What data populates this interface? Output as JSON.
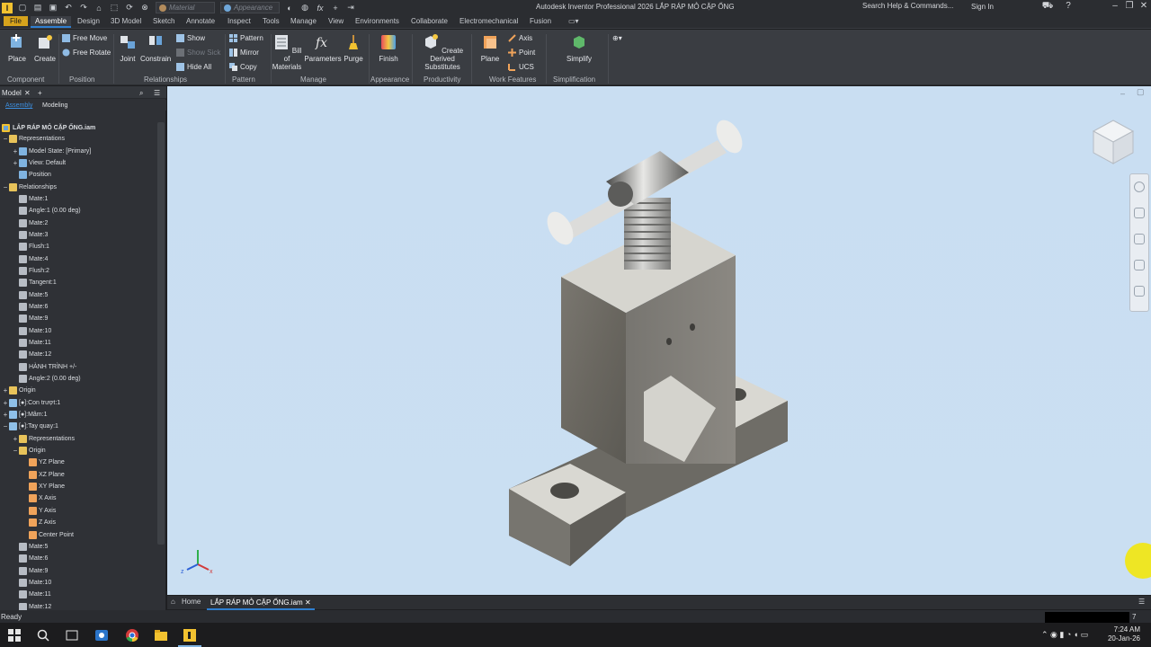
{
  "window": {
    "title": "Autodesk Inventor Professional 2026   LẮP RÁP MỎ CẶP ỐNG",
    "search_placeholder": "Search Help & Commands...",
    "sign_in": "Sign In",
    "material_placeholder": "Material",
    "appearance_placeholder": "Appearance",
    "app_logo": "I"
  },
  "ribbon_tabs": [
    "File",
    "Assemble",
    "Design",
    "3D Model",
    "Sketch",
    "Annotate",
    "Inspect",
    "Tools",
    "Manage",
    "View",
    "Environments",
    "Collaborate",
    "Electromechanical",
    "Fusion"
  ],
  "active_tab": "Assemble",
  "ribbon": {
    "place": "Place",
    "create": "Create",
    "free_move": "Free Move",
    "free_rotate": "Free Rotate",
    "joint": "Joint",
    "constrain": "Constrain",
    "show": "Show",
    "show_sick": "Show Sick",
    "hide_all": "Hide All",
    "pattern": "Pattern",
    "mirror": "Mirror",
    "copy": "Copy",
    "bom_1": "Bill of",
    "bom_2": "Materials",
    "parameters": "Parameters",
    "purge": "Purge",
    "finish": "Finish",
    "derived_1": "Create Derived",
    "derived_2": "Substitutes",
    "plane": "Plane",
    "axis": "Axis",
    "point": "Point",
    "ucs": "UCS",
    "simplify": "Simplify",
    "panels": {
      "component": "Component",
      "position": "Position",
      "relationships": "Relationships",
      "pattern": "Pattern",
      "manage": "Manage",
      "appearance": "Appearance",
      "productivity": "Productivity",
      "work_features": "Work Features",
      "simplification": "Simplification"
    }
  },
  "browser": {
    "title": "Model",
    "tab_assembly": "Assembly",
    "tab_modeling": "Modeling",
    "root": "LẮP RÁP MỎ CẶP ỐNG.iam",
    "items": [
      {
        "label": "Representations",
        "level": 1,
        "exp": "−",
        "icon": "folder-icon"
      },
      {
        "label": "Model State: [Primary]",
        "level": 2,
        "exp": "+",
        "icon": "model-state-icon"
      },
      {
        "label": "View: Default",
        "level": 2,
        "exp": "+",
        "icon": "view-icon"
      },
      {
        "label": "Position",
        "level": 2,
        "exp": "",
        "icon": "position-icon"
      },
      {
        "label": "Relationships",
        "level": 1,
        "exp": "−",
        "icon": "folder-icon"
      },
      {
        "label": "Mate:1",
        "level": 2,
        "exp": "",
        "icon": "mate-icon"
      },
      {
        "label": "Angle:1 (0.00 deg)",
        "level": 2,
        "exp": "",
        "icon": "angle-icon"
      },
      {
        "label": "Mate:2",
        "level": 2,
        "exp": "",
        "icon": "mate-icon"
      },
      {
        "label": "Mate:3",
        "level": 2,
        "exp": "",
        "icon": "mate-icon"
      },
      {
        "label": "Flush:1",
        "level": 2,
        "exp": "",
        "icon": "flush-icon"
      },
      {
        "label": "Mate:4",
        "level": 2,
        "exp": "",
        "icon": "mate-icon"
      },
      {
        "label": "Flush:2",
        "level": 2,
        "exp": "",
        "icon": "flush-icon"
      },
      {
        "label": "Tangent:1",
        "level": 2,
        "exp": "",
        "icon": "tangent-icon"
      },
      {
        "label": "Mate:5",
        "level": 2,
        "exp": "",
        "icon": "mate-icon"
      },
      {
        "label": "Mate:6",
        "level": 2,
        "exp": "",
        "icon": "mate-icon"
      },
      {
        "label": "Mate:9",
        "level": 2,
        "exp": "",
        "icon": "mate-icon"
      },
      {
        "label": "Mate:10",
        "level": 2,
        "exp": "",
        "icon": "mate-icon"
      },
      {
        "label": "Mate:11",
        "level": 2,
        "exp": "",
        "icon": "mate-icon"
      },
      {
        "label": "Mate:12",
        "level": 2,
        "exp": "",
        "icon": "mate-icon"
      },
      {
        "label": "HÀNH TRÌNH +/-",
        "level": 2,
        "exp": "",
        "icon": "mate-icon"
      },
      {
        "label": "Angle:2 (0.00 deg)",
        "level": 2,
        "exp": "",
        "icon": "angle-icon"
      },
      {
        "label": "Origin",
        "level": 1,
        "exp": "+",
        "icon": "folder-icon"
      },
      {
        "label": "[●]:Con trượt:1",
        "level": 1,
        "exp": "+",
        "icon": "part-icon"
      },
      {
        "label": "[●]:Mâm:1",
        "level": 1,
        "exp": "+",
        "icon": "part-icon"
      },
      {
        "label": "[●]:Tay quay:1",
        "level": 1,
        "exp": "−",
        "icon": "part-icon"
      },
      {
        "label": "Representations",
        "level": 2,
        "exp": "+",
        "icon": "folder-icon"
      },
      {
        "label": "Origin",
        "level": 2,
        "exp": "−",
        "icon": "folder-icon"
      },
      {
        "label": "YZ Plane",
        "level": 3,
        "exp": "",
        "icon": "plane-icon"
      },
      {
        "label": "XZ Plane",
        "level": 3,
        "exp": "",
        "icon": "plane-icon"
      },
      {
        "label": "XY Plane",
        "level": 3,
        "exp": "",
        "icon": "plane-icon"
      },
      {
        "label": "X Axis",
        "level": 3,
        "exp": "",
        "icon": "axis-icon"
      },
      {
        "label": "Y Axis",
        "level": 3,
        "exp": "",
        "icon": "axis-icon"
      },
      {
        "label": "Z Axis",
        "level": 3,
        "exp": "",
        "icon": "axis-icon"
      },
      {
        "label": "Center Point",
        "level": 3,
        "exp": "",
        "icon": "center-point-icon"
      },
      {
        "label": "Mate:5",
        "level": 2,
        "exp": "",
        "icon": "mate-icon"
      },
      {
        "label": "Mate:6",
        "level": 2,
        "exp": "",
        "icon": "mate-icon"
      },
      {
        "label": "Mate:9",
        "level": 2,
        "exp": "",
        "icon": "mate-icon"
      },
      {
        "label": "Mate:10",
        "level": 2,
        "exp": "",
        "icon": "mate-icon"
      },
      {
        "label": "Mate:11",
        "level": 2,
        "exp": "",
        "icon": "mate-icon"
      },
      {
        "label": "Mate:12",
        "level": 2,
        "exp": "",
        "icon": "mate-icon"
      }
    ]
  },
  "doc_tabs": {
    "home": "Home",
    "active": "LẮP RÁP MỎ CẶP ỐNG.iam",
    "page": "7"
  },
  "status": "Ready",
  "clock": {
    "time": "7:24 AM",
    "date": "20-Jan-26"
  },
  "axis_labels": {
    "x": "x",
    "y": "y",
    "z": "z"
  },
  "colors": {
    "accent": "#2f7fd1",
    "file_tab": "#d6a31c",
    "viewport": "#c9def2"
  }
}
